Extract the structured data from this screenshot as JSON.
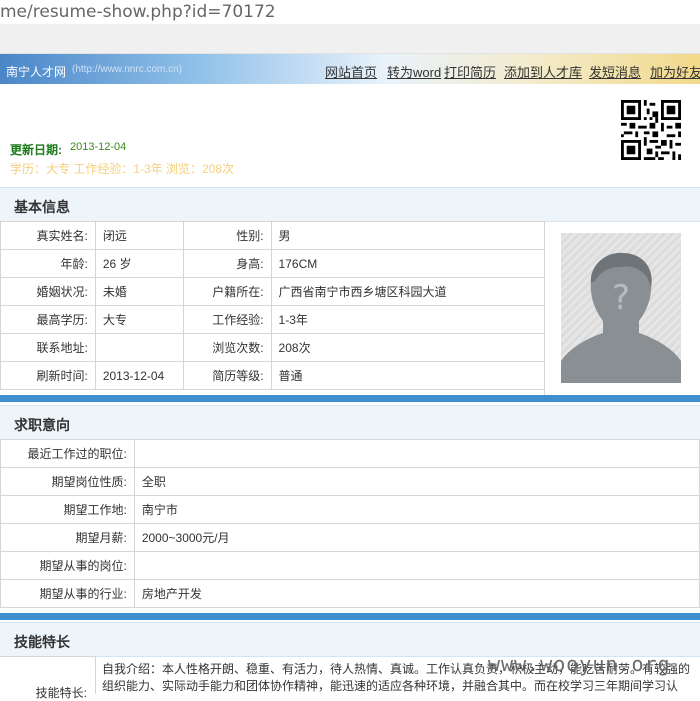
{
  "browser": {
    "url": "me/resume-show.php?id=70172"
  },
  "site": {
    "brand": "南宁人才网",
    "brand_url": "(http://www.nnrc.com.cn)"
  },
  "nav": [
    "网站首页",
    "转为word",
    "打印简历",
    "添加到人才库",
    "发短消息",
    "加为好友"
  ],
  "header": {
    "updated_label": "更新日期:",
    "updated_value": "2013-12-04",
    "sub_info": "学历：大专   工作经验：1-3年   浏览：208次"
  },
  "sections": {
    "basic": "基本信息",
    "intent": "求职意向",
    "skills": "技能特长"
  },
  "basic": {
    "name_label": "真实姓名:",
    "name": "闭远",
    "gender_label": "性别:",
    "gender": "男",
    "age_label": "年龄:",
    "age": "26 岁",
    "height_label": "身高:",
    "height": "176CM",
    "marital_label": "婚姻状况:",
    "marital": "未婚",
    "hukou_label": "户籍所在:",
    "hukou": "广西省南宁市西乡塘区科园大道",
    "edu_label": "最高学历:",
    "edu": "大专",
    "exp_label": "工作经验:",
    "exp": "1-3年",
    "addr_label": "联系地址:",
    "addr": "",
    "views_label": "浏览次数:",
    "views": "208次",
    "refresh_label": "刷新时间:",
    "refresh": "2013-12-04",
    "level_label": "简历等级:",
    "level": "普通"
  },
  "intent": {
    "last_pos_label": "最近工作过的职位:",
    "last_pos": "",
    "nature_label": "期望岗位性质:",
    "nature": "全职",
    "place_label": "期望工作地:",
    "place": "南宁市",
    "salary_label": "期望月薪:",
    "salary": "2000~3000元/月",
    "job_label": "期望从事的岗位:",
    "job": "",
    "industry_label": "期望从事的行业:",
    "industry": "房地产开发"
  },
  "skills": {
    "label": "技能特长:",
    "text": "自我介绍：本人性格开朗、稳重、有活力，待人热情、真诚。工作认真负责，积极主动，能吃苦耐劳。有较强的组织能力、实际动手能力和团体协作精神，能迅速的适应各种环境，并融合其中。而在校学习三年期间学习认"
  },
  "watermark": "www.wooyun.org"
}
